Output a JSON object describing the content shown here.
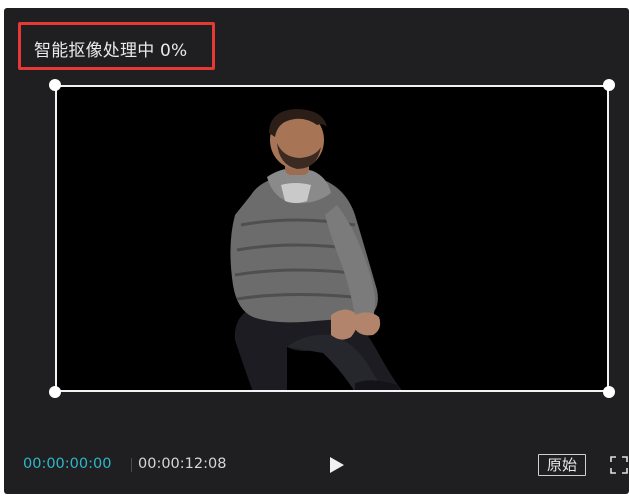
{
  "header": {
    "status_text": "智能抠像处理中 0%",
    "progress_percent": 0,
    "highlight_color": "#e53935"
  },
  "preview": {
    "subject_description": "",
    "background_color": "#000000",
    "selection_color": "#f2f2f2"
  },
  "controls": {
    "current_time": "00:00:00:00",
    "total_time": "00:00:12:08",
    "current_time_color": "#2fb7c9",
    "play_icon": "play-icon",
    "original_label": "原始",
    "fullscreen_icon": "fullscreen-icon"
  }
}
